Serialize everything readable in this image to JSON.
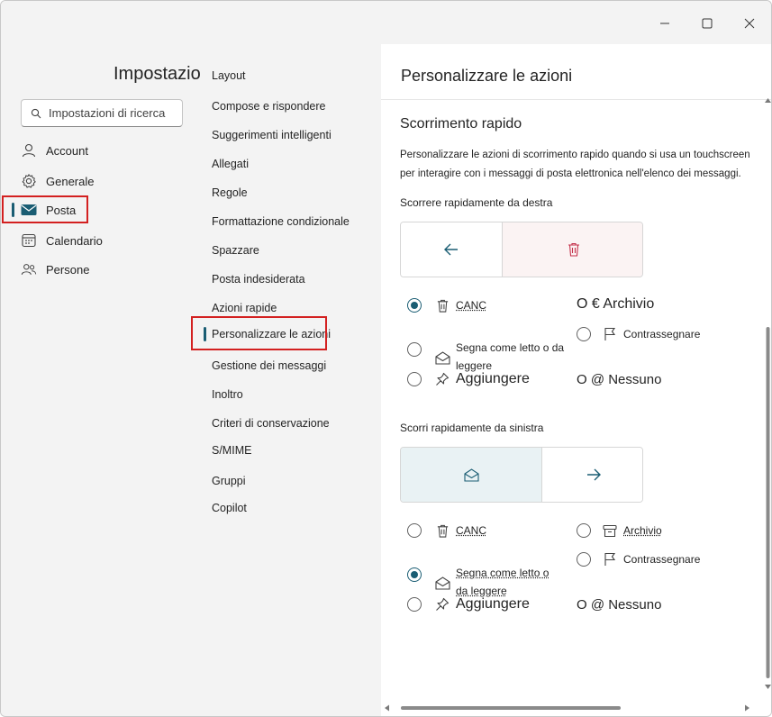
{
  "settings": {
    "title": "Impostazioni",
    "search_placeholder": "Impostazioni di ricerca"
  },
  "nav": {
    "items": [
      {
        "label": "Account",
        "icon": "person-icon"
      },
      {
        "label": "Generale",
        "icon": "gear-icon"
      },
      {
        "label": "Posta",
        "icon": "mail-icon",
        "selected": true
      },
      {
        "label": "Calendario",
        "icon": "calendar-icon"
      },
      {
        "label": "Persone",
        "icon": "people-icon"
      }
    ]
  },
  "mail_nav": {
    "items": [
      {
        "label": "Layout"
      },
      {
        "label": "Compose e rispondere"
      },
      {
        "label": "Suggerimenti intelligenti"
      },
      {
        "label": "Allegati"
      },
      {
        "label": "Regole"
      },
      {
        "label": "Formattazione condizionale"
      },
      {
        "label": "Spazzare"
      },
      {
        "label": "Posta indesiderata"
      },
      {
        "label": "Azioni rapide"
      },
      {
        "label": "Personalizzare le azioni",
        "selected": true
      },
      {
        "label": "Gestione dei messaggi"
      },
      {
        "label": "Inoltro"
      },
      {
        "label": "Criteri di conservazione"
      },
      {
        "label": "S/MIME"
      },
      {
        "label": "Gruppi"
      },
      {
        "label": "Copilot"
      }
    ]
  },
  "panel": {
    "title": "Personalizzare le azioni",
    "section_title": "Scorrimento rapido",
    "description": "Personalizzare le azioni di scorrimento rapido quando si usa un touchscreen per interagire con i messaggi di posta elettronica nell'elenco dei messaggi.",
    "right": {
      "label": "Scorrere rapidamente da destra",
      "options": {
        "delete": "CANC",
        "archive": "O € Archivio",
        "mark_read": "Segna come letto o da leggere",
        "flag": "Contrassegnare",
        "pin": "Aggiungere",
        "none": "O @ Nessuno"
      },
      "selected": "delete"
    },
    "left": {
      "label": "Scorri rapidamente da sinistra",
      "options": {
        "delete": "CANC",
        "archive": "Archivio",
        "mark_read": "Segna come letto o da leggere",
        "flag": "Contrassegnare",
        "pin": "Aggiungere",
        "none": "O @ Nessuno"
      },
      "selected": "mark_read"
    }
  },
  "colors": {
    "accent": "#1a5d73",
    "delete_red": "#c4314b",
    "highlight_box": "#d32020",
    "delete_bg": "#fbf3f3",
    "read_bg": "#e9f2f4"
  }
}
